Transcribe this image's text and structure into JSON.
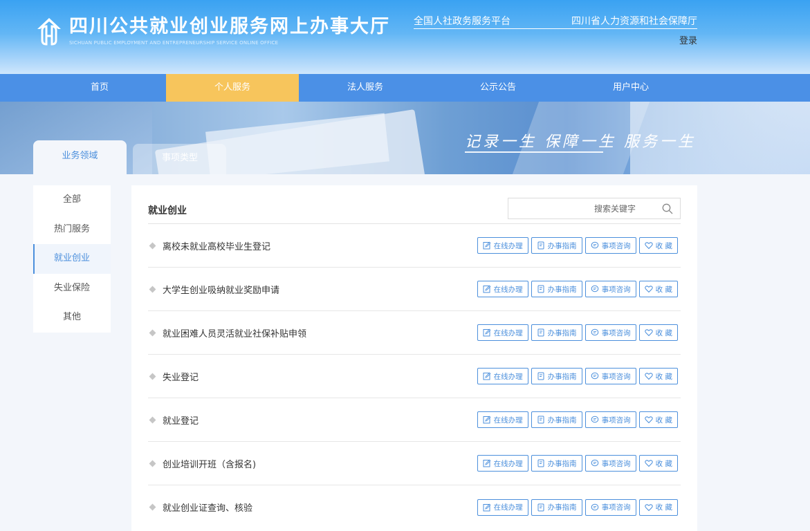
{
  "header": {
    "title": "四川公共就业创业服务网上办事大厅",
    "subtitle": "SICHUAN PUBLIC EMPLOYMENT AND ENTREPRENEURSHIP SERVICE ONLINE OFFICE",
    "links": [
      "全国人社政务服务平台",
      "四川省人力资源和社会保障厅"
    ],
    "login": "登录"
  },
  "nav": [
    "首页",
    "个人服务",
    "法人服务",
    "公示公告",
    "用户中心"
  ],
  "nav_active": "个人服务",
  "banner": {
    "slogan": "记录一生  保障一生  服务一生"
  },
  "tabs": {
    "area": "业务领域",
    "type": "事项类型"
  },
  "sidebar": [
    "全部",
    "热门服务",
    "就业创业",
    "失业保险",
    "其他"
  ],
  "sidebar_active": "就业创业",
  "main": {
    "title": "就业创业",
    "search_placeholder": "搜索关键字",
    "items": [
      "离校未就业高校毕业生登记",
      "大学生创业吸纳就业奖励申请",
      "就业困难人员灵活就业社保补贴申领",
      "失业登记",
      "就业登记",
      "创业培训开班（含报名)",
      "就业创业证查询、核验"
    ],
    "actions": {
      "online": "在线办理",
      "guide": "办事指南",
      "consult": "事项咨询",
      "favorite": "收  藏"
    }
  },
  "colors": {
    "accent": "#4b8fdc",
    "nav": "#4b90e6",
    "nav_active": "#f7c55c"
  }
}
